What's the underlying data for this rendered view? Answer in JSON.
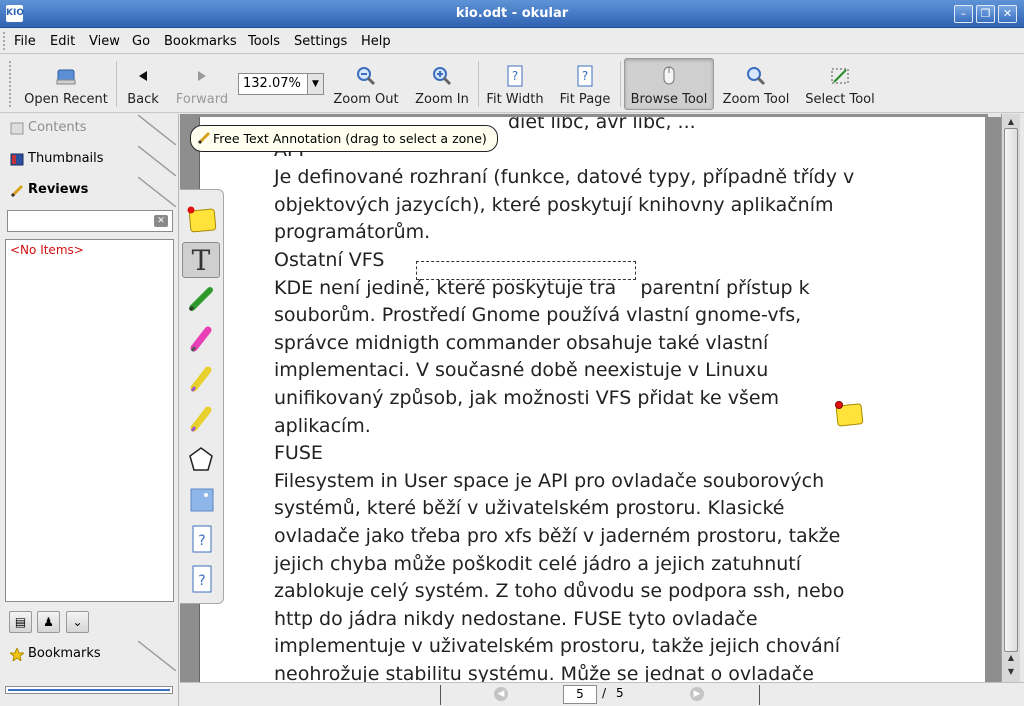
{
  "window": {
    "title": "kio.odt - okular"
  },
  "menu": [
    "File",
    "Edit",
    "View",
    "Go",
    "Bookmarks",
    "Tools",
    "Settings",
    "Help"
  ],
  "toolbar": {
    "open_recent": "Open Recent",
    "back": "Back",
    "forward": "Forward",
    "zoom_value": "132.07%",
    "zoom_out": "Zoom Out",
    "zoom_in": "Zoom In",
    "fit_width": "Fit Width",
    "fit_page": "Fit Page",
    "browse_tool": "Browse Tool",
    "zoom_tool": "Zoom Tool",
    "select_tool": "Select Tool"
  },
  "sidebar": {
    "tabs": [
      "Contents",
      "Thumbnails",
      "Reviews"
    ],
    "filter_value": "",
    "empty_text": "<No Items>",
    "bookmarks": "Bookmarks"
  },
  "tooltip": "Free Text Annotation (drag to select a zone)",
  "document": {
    "lines": [
      "diet libc, avr libc, ...",
      "API",
      "Je definované rozhraní (funkce, datové typy, případně třídy v",
      "objektových jazycích), které poskytují knihovny aplikačním",
      "programátorům.",
      "Ostatní VFS",
      "KDE není jediné, které poskytuje tra    parentní přístup k",
      "souborům. Prostředí Gnome používá vlastní gnome-vfs,",
      "správce midnigth commander obsahuje také vlastní",
      "implementaci. V současné době neexistuje v Linuxu",
      "unifikovaný způsob, jak možnosti VFS přidat ke všem",
      "aplikacím.",
      "FUSE",
      "Filesystem in User space je API pro ovladače souborových",
      "systémů, které běží v uživatelském prostoru. Klasické",
      "ovladače jako třeba pro xfs běží v jaderném prostoru, takže",
      "jejich chyba může poškodit celé jádro a jejich zatuhnutí",
      "zablokuje celý systém. Z toho důvodu se podpora ssh, nebo",
      "http do jádra nikdy nedostane. FUSE tyto ovladače",
      "implementuje v uživatelském prostoru, takže jejich chování",
      "neohrožuje stabilitu systému. Může se jednat o ovladače"
    ]
  },
  "status": {
    "current_page": "5",
    "separator": "/",
    "total_pages": "5"
  },
  "colors": {
    "titlebar": "#2f63b3",
    "empty_text": "#d01010",
    "note_yellow": "#ffe23a"
  }
}
